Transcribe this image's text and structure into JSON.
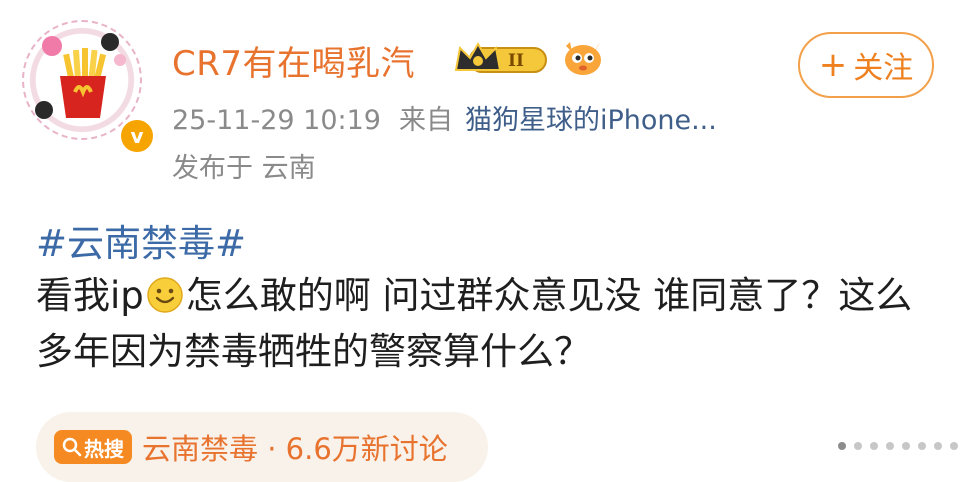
{
  "user": {
    "name": "CR7有在喝乳汽",
    "vip_level": "II"
  },
  "post": {
    "timestamp": "25-11-29 10:19",
    "source_label": "来自",
    "device": "猫狗星球的iPhone...",
    "location": "发布于 云南",
    "hashtag": "#云南禁毒#",
    "text_part1": "看我ip",
    "text_part2": "怎么敢的啊 问过群众意见没 谁同意了？这么多年因为禁毒牺牲的警察算什么？"
  },
  "follow": {
    "plus": "+",
    "label": "关注"
  },
  "trend": {
    "badge_label": "热搜",
    "text": "云南禁毒 · 6.6万新讨论"
  },
  "colors": {
    "accent": "#e8732e",
    "link": "#3c6aa6",
    "follow_border": "#f3a04a",
    "trend_bg": "#f8f2ea",
    "trend_badge": "#f68a22"
  }
}
